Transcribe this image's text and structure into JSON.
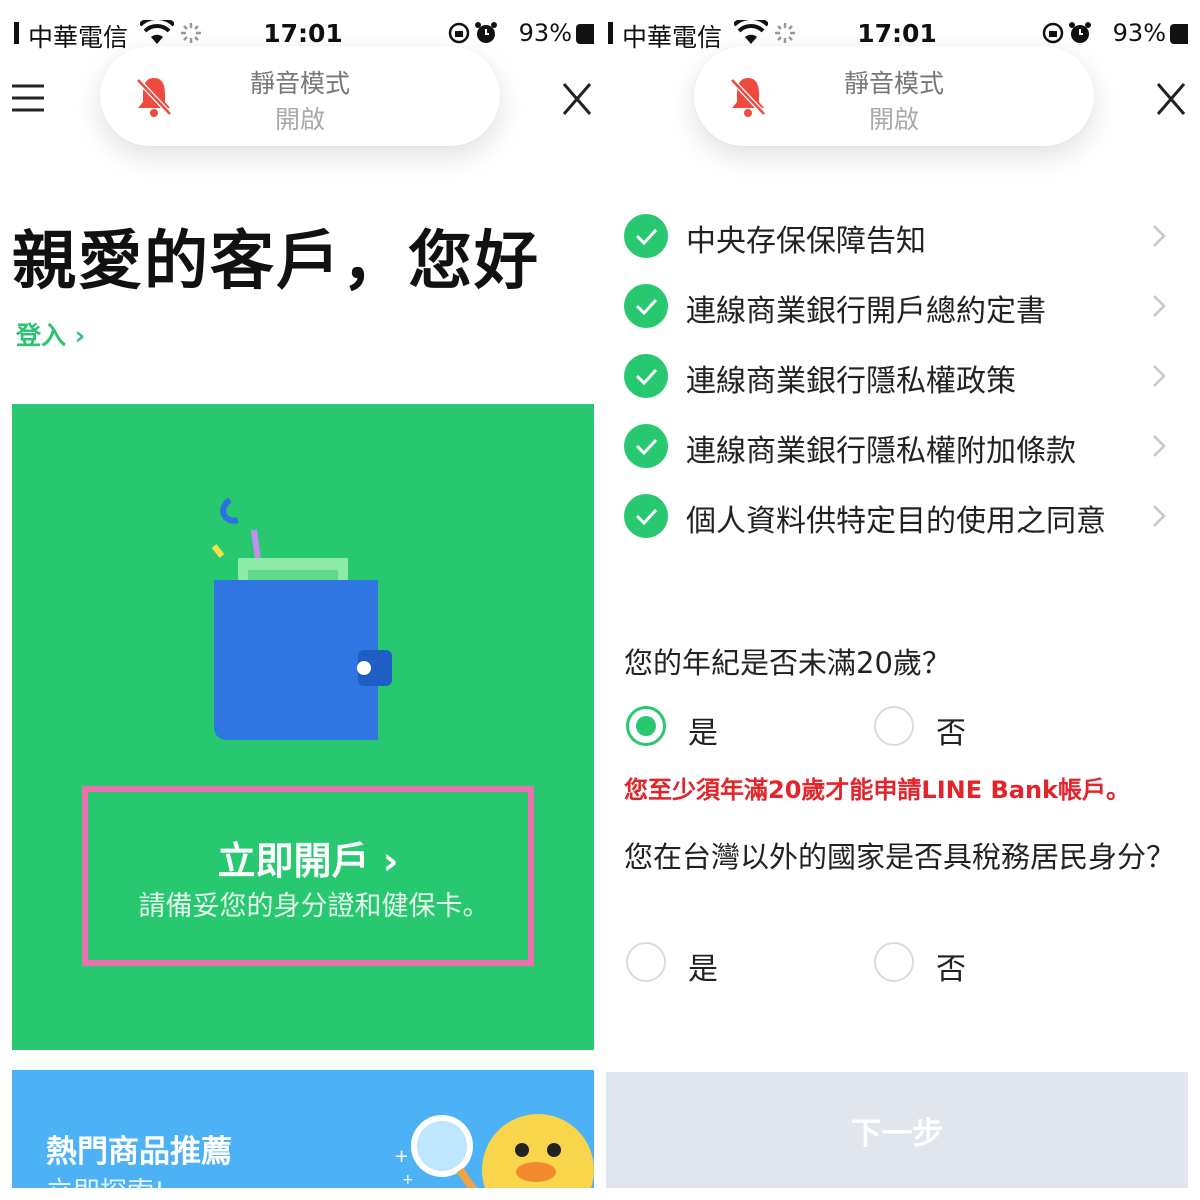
{
  "status_bar": {
    "carrier": "中華電信",
    "time": "17:01",
    "battery": "93%"
  },
  "toast": {
    "title": "靜音模式",
    "subtitle": "開啟"
  },
  "left": {
    "greeting": "親愛的客戶，您好",
    "login": "登入 ›",
    "cta_title": "立即開戶 ›",
    "cta_subtitle": "請備妥您的身分證和健保卡。",
    "hot_title": "熱門商品推薦",
    "hot_subtitle": "立即探索!"
  },
  "right": {
    "agreements": [
      "中央存保保障告知",
      "連線商業銀行開戶總約定書",
      "連線商業銀行隱私權政策",
      "連線商業銀行隱私權附加條款",
      "個人資料供特定目的使用之同意"
    ],
    "q1": {
      "text": "您的年紀是否未滿20歲？",
      "yes": "是",
      "no": "否",
      "selected": "是"
    },
    "error": "您至少須年滿20歲才能申請LINE Bank帳戶。",
    "q2": {
      "text": "您在台灣以外的國家是否具稅務居民身分？",
      "yes": "是",
      "no": "否"
    },
    "next": "下一步"
  },
  "colors": {
    "brand_green": "#27c870",
    "error_red": "#e3242b",
    "highlight_pink": "#ec6fae",
    "promo_blue": "#4db1f5"
  },
  "icons": [
    "menu-icon",
    "close-icon",
    "bell-slash-icon",
    "wifi-icon",
    "alarm-icon",
    "check-circle-icon",
    "chevron-right-icon",
    "wallet-icon",
    "magnifier-icon",
    "duck-icon"
  ]
}
